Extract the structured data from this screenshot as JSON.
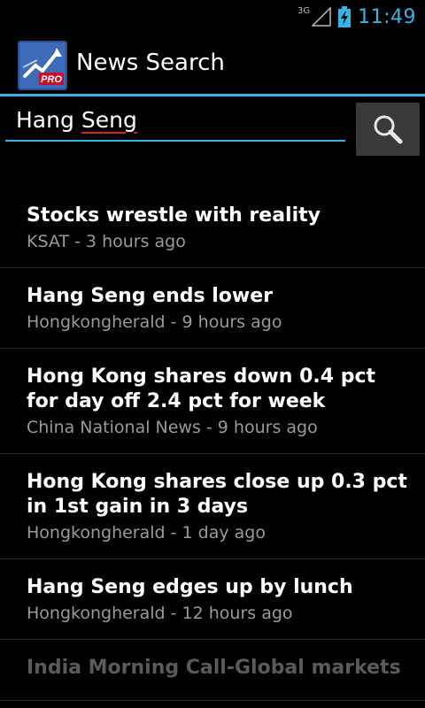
{
  "status_bar": {
    "network": "3G",
    "time": "11:49"
  },
  "action_bar": {
    "title": "News Search",
    "icon_badge": "PRO"
  },
  "search": {
    "query_word1": "Hang",
    "query_word2": "Seng"
  },
  "news": [
    {
      "title": "Stocks wrestle with reality",
      "meta": "KSAT - 3 hours ago"
    },
    {
      "title": "Hang Seng ends lower",
      "meta": "Hongkongherald - 9 hours ago"
    },
    {
      "title": "Hong Kong shares down 0.4 pct for day off 2.4 pct for week",
      "meta": "China National News - 9 hours ago"
    },
    {
      "title": "Hong Kong shares close up 0.3 pct in 1st gain in 3 days",
      "meta": "Hongkongherald - 1 day ago"
    },
    {
      "title": "Hang Seng edges up by lunch",
      "meta": "Hongkongherald - 12 hours ago"
    },
    {
      "title": "India Morning Call-Global markets",
      "meta": ""
    }
  ],
  "colors": {
    "accent": "#33b5e5",
    "background": "#000000",
    "meta_text": "#9a9a9a"
  }
}
